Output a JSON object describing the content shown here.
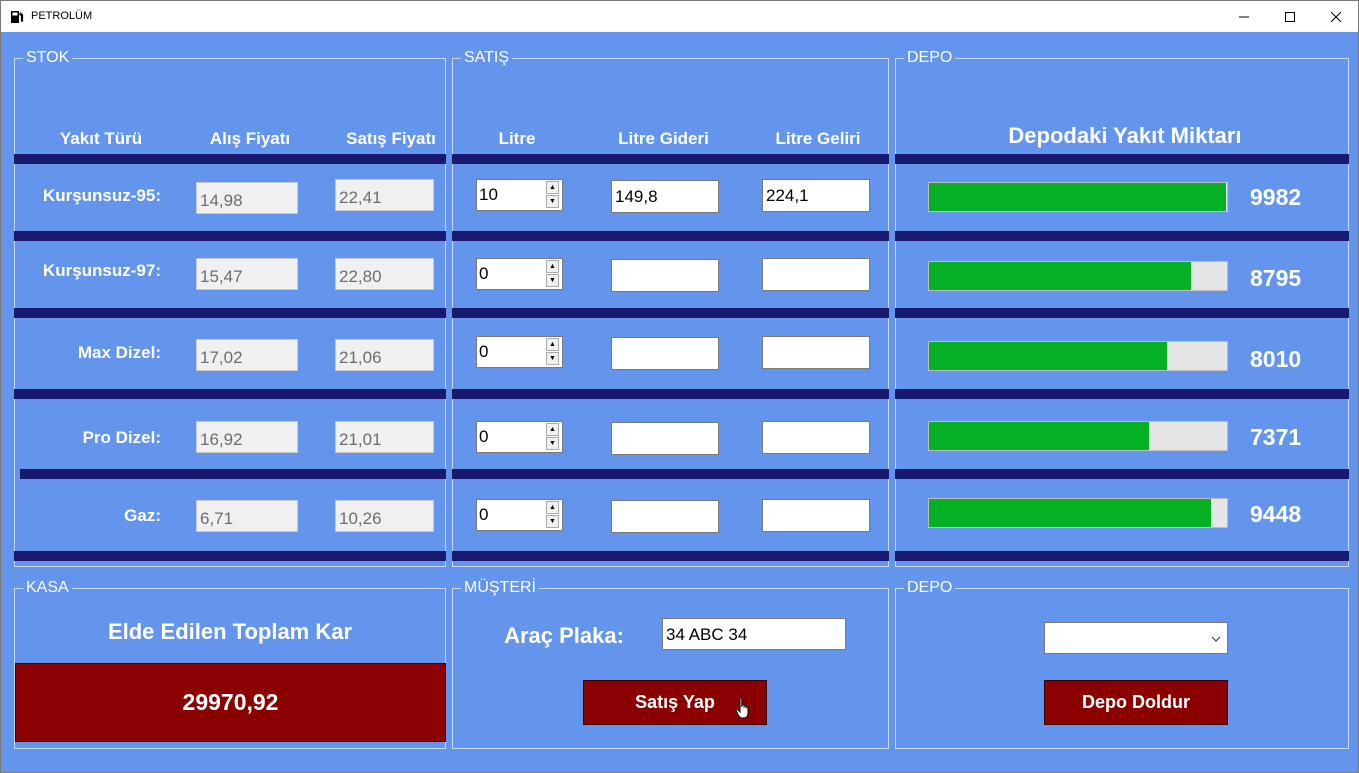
{
  "window": {
    "title": "PETROLÜM",
    "app_icon": "fuel-pump-icon"
  },
  "stock": {
    "title": "STOK",
    "headers": [
      "Yakıt Türü",
      "Alış Fiyatı",
      "Satış Fiyatı"
    ],
    "rows": [
      {
        "fuel": "Kurşunsuz-95:",
        "buy": "14,98",
        "sell": "22,41"
      },
      {
        "fuel": "Kurşunsuz-97:",
        "buy": "15,47",
        "sell": "22,80"
      },
      {
        "fuel": "Max Dizel:",
        "buy": "17,02",
        "sell": "21,06"
      },
      {
        "fuel": "Pro Dizel:",
        "buy": "16,92",
        "sell": "21,01"
      },
      {
        "fuel": "Gaz:",
        "buy": "6,71",
        "sell": "10,26"
      }
    ]
  },
  "sale": {
    "title": "SATIŞ",
    "headers": [
      "Litre",
      "Litre Gideri",
      "Litre Geliri"
    ],
    "rows": [
      {
        "litre": "10",
        "cost": "149,8",
        "revenue": "224,1"
      },
      {
        "litre": "0",
        "cost": "",
        "revenue": ""
      },
      {
        "litre": "0",
        "cost": "",
        "revenue": ""
      },
      {
        "litre": "0",
        "cost": "",
        "revenue": ""
      },
      {
        "litre": "0",
        "cost": "",
        "revenue": ""
      }
    ]
  },
  "depot": {
    "title": "DEPO",
    "heading": "Depodaki Yakıt Miktarı",
    "bar_color": "#06b025",
    "levels": [
      {
        "amount": "9982",
        "fill_percent": 99.8
      },
      {
        "amount": "8795",
        "fill_percent": 88
      },
      {
        "amount": "8010",
        "fill_percent": 80
      },
      {
        "amount": "7371",
        "fill_percent": 73.7
      },
      {
        "amount": "9448",
        "fill_percent": 94.5
      }
    ]
  },
  "cash": {
    "title": "KASA",
    "heading": "Elde Edilen Toplam Kar",
    "total": "29970,92",
    "box_color": "#8b0000"
  },
  "customer": {
    "title": "MÜŞTERİ",
    "plate_label": "Araç Plaka:",
    "plate_value": "34 ABC 34",
    "sell_button": "Satış Yap"
  },
  "depot_fill": {
    "title": "DEPO",
    "combo_value": "",
    "fill_button": "Depo Doldur"
  }
}
